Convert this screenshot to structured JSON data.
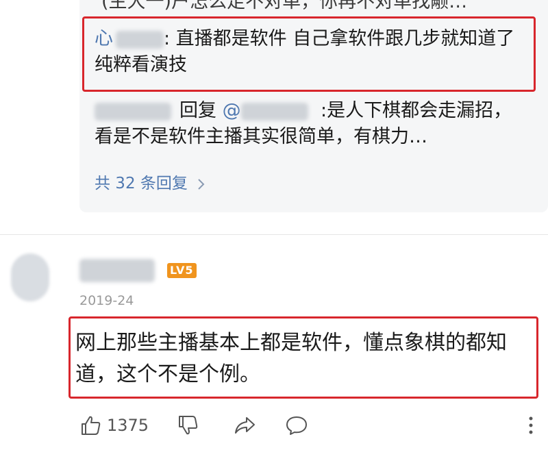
{
  "thread": {
    "cut_line": "(主大一)户怎么走不对单，你再不对单找颟…",
    "reply_1": {
      "user": "心",
      "text": ": 直播都是软件 自己拿软件跟几步就知道了 纯粹看演技"
    },
    "reply_2": {
      "reply_word": "回复",
      "at": "@",
      "text": ":是人下棋都会走漏招，看是不是软件主播其实很简单，有棋力…"
    },
    "more_replies": "共 32 条回复"
  },
  "comment": {
    "level": "LV5",
    "date": "2019-24",
    "text": "网上那些主播基本上都是软件，懂点象棋的都知道，这个不是个例。",
    "like_count": "1375"
  },
  "colors": {
    "highlight_border": "#d8262c",
    "link_blue": "#4f78b0",
    "level_badge": "#f0941e"
  },
  "icons": [
    "thumbs-up-icon",
    "thumbs-down-icon",
    "share-icon",
    "comment-icon",
    "more-icon",
    "chevron-right-icon"
  ]
}
